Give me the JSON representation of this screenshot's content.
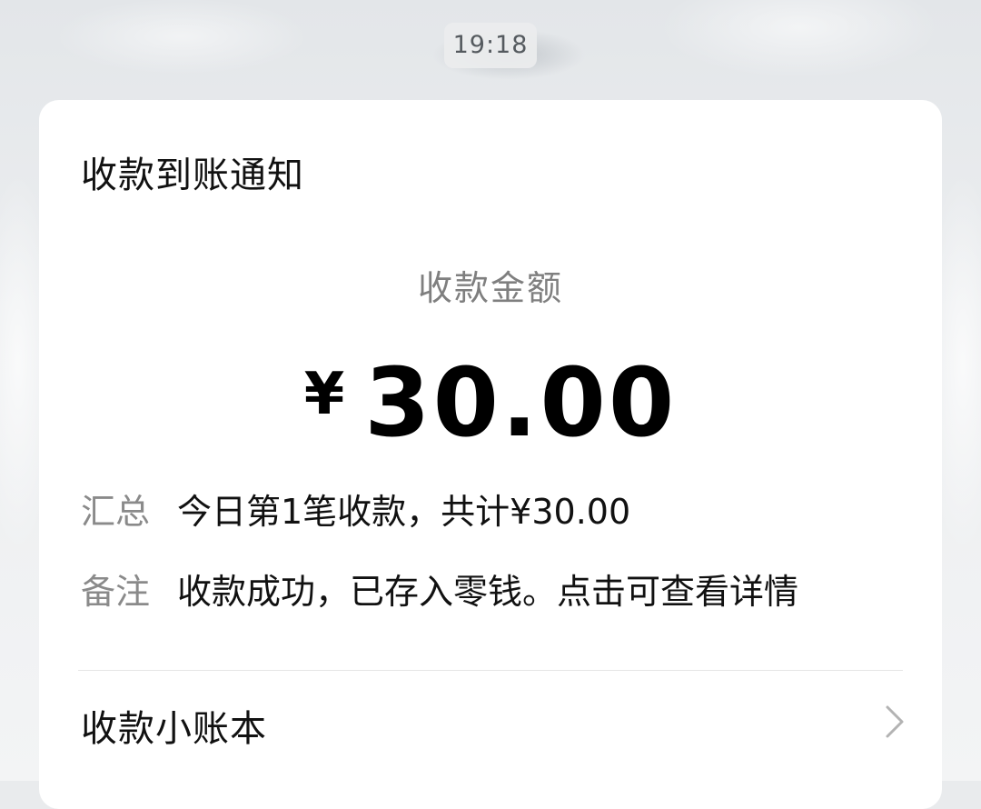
{
  "timestamp": "19:18",
  "notification": {
    "title": "收款到账通知",
    "amount_label": "收款金额",
    "currency_symbol": "¥",
    "amount": "30.00",
    "summary": {
      "label": "汇总",
      "value": "今日第1笔收款，共计¥30.00"
    },
    "remark": {
      "label": "备注",
      "value": "收款成功，已存入零钱。点击可查看详情"
    },
    "ledger_link": {
      "label": "收款小账本",
      "icon": "chevron-right-icon"
    }
  },
  "colors": {
    "card_background": "#ffffff",
    "secondary_text": "#8a8a8a",
    "primary_text": "#111111"
  }
}
